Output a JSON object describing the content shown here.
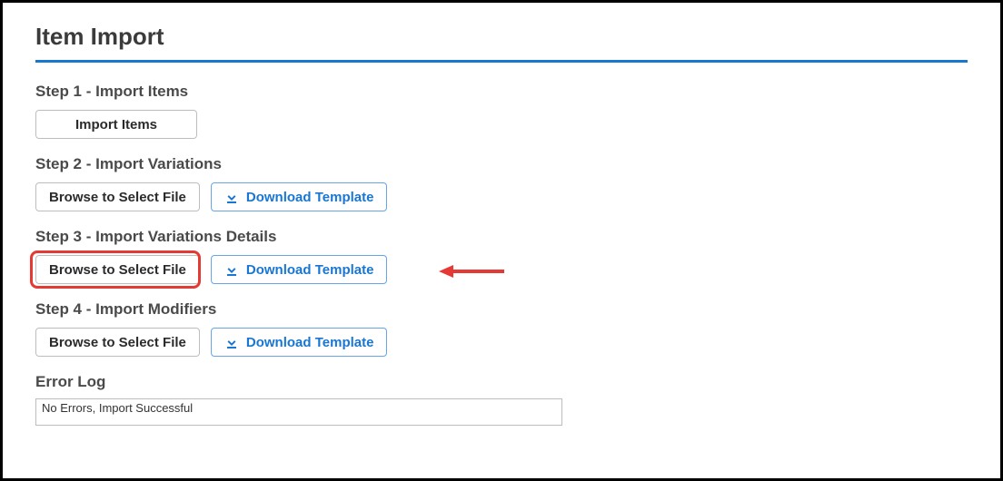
{
  "page": {
    "title": "Item Import"
  },
  "steps": {
    "step1": {
      "heading": "Step 1 - Import Items",
      "button": "Import Items"
    },
    "step2": {
      "heading": "Step 2 - Import Variations",
      "browse": "Browse to Select File",
      "download": "Download Template"
    },
    "step3": {
      "heading": "Step 3 - Import Variations Details",
      "browse": "Browse to Select File",
      "download": "Download Template"
    },
    "step4": {
      "heading": "Step 4 - Import Modifiers",
      "browse": "Browse to Select File",
      "download": "Download Template"
    }
  },
  "errorlog": {
    "heading": "Error Log",
    "message": "No Errors, Import Successful"
  },
  "colors": {
    "accent": "#1976d2",
    "highlight": "#e53935"
  }
}
